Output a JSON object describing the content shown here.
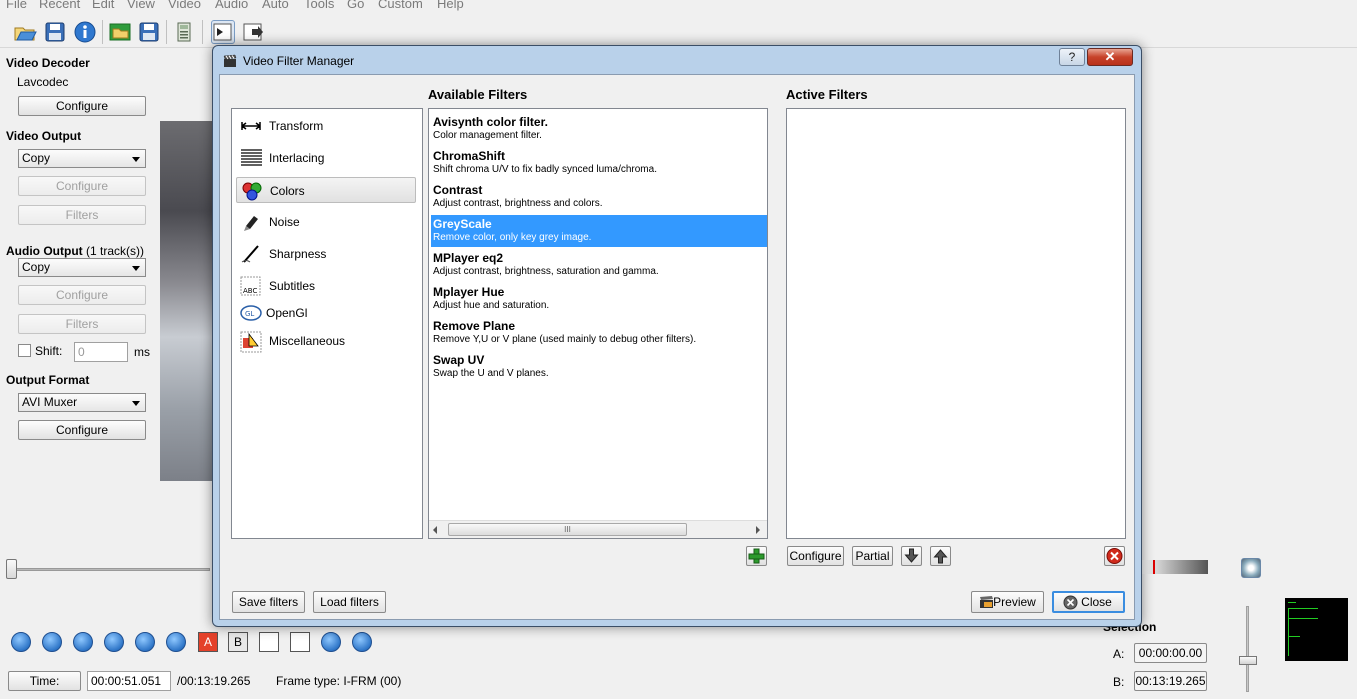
{
  "menu": [
    "File",
    "Recent",
    "Edit",
    "View",
    "Video",
    "Audio",
    "Auto",
    "Tools",
    "Go",
    "Custom",
    "Help"
  ],
  "left_panel": {
    "video_decoder": {
      "title": "Video Decoder",
      "codec": "Lavcodec",
      "configure": "Configure"
    },
    "video_output": {
      "title": "Video Output",
      "selected": "Copy",
      "configure": "Configure",
      "filters": "Filters"
    },
    "audio_output": {
      "title": "Audio Output",
      "tracks": "(1 track(s))",
      "selected": "Copy",
      "configure": "Configure",
      "filters": "Filters",
      "shift_label": "Shift:",
      "shift_value": "0",
      "shift_unit": "ms"
    },
    "output_format": {
      "title": "Output Format",
      "selected": "AVI Muxer",
      "configure": "Configure"
    }
  },
  "bottom": {
    "time_button": "Time:",
    "current_time": "00:00:51.051",
    "total_time": "/00:13:19.265",
    "frame_type": "Frame type:  I-FRM (00)",
    "selection_title": "Selection",
    "a_label": "A:",
    "a_value": "00:00:00.00",
    "b_label": "B:",
    "b_value": "00:13:19.265",
    "marker_a": "A",
    "marker_b": "B"
  },
  "dialog": {
    "title": "Video Filter Manager",
    "help": "?",
    "close_x": "✕",
    "categories": [
      {
        "label": "Transform",
        "icon": "transform-icon"
      },
      {
        "label": "Interlacing",
        "icon": "interlacing-icon"
      },
      {
        "label": "Colors",
        "icon": "colors-icon"
      },
      {
        "label": "Noise",
        "icon": "noise-icon"
      },
      {
        "label": "Sharpness",
        "icon": "sharpness-icon"
      },
      {
        "label": "Subtitles",
        "icon": "subtitles-icon"
      },
      {
        "label": "OpenGl",
        "icon": "opengl-icon"
      },
      {
        "label": "Miscellaneous",
        "icon": "miscellaneous-icon"
      }
    ],
    "selected_category": "Colors",
    "available_header": "Available Filters",
    "active_header": "Active Filters",
    "filters": [
      {
        "name": "Avisynth color filter.",
        "desc": "Color management filter."
      },
      {
        "name": "ChromaShift",
        "desc": "Shift chroma U/V to fix badly synced luma/chroma."
      },
      {
        "name": "Contrast",
        "desc": "Adjust contrast, brightness and colors."
      },
      {
        "name": "GreyScale",
        "desc": "Remove color, only key grey image."
      },
      {
        "name": "MPlayer eq2",
        "desc": "Adjust contrast, brightness, saturation and gamma."
      },
      {
        "name": "Mplayer Hue",
        "desc": "Adjust hue and saturation."
      },
      {
        "name": "Remove Plane",
        "desc": "Remove Y,U or V plane (used mainly to debug other filters)."
      },
      {
        "name": "Swap UV",
        "desc": "Swap the U and V planes."
      }
    ],
    "selected_filter": "GreyScale",
    "configure": "Configure",
    "partial": "Partial",
    "save_filters": "Save filters",
    "load_filters": "Load filters",
    "preview": "Preview",
    "close": "Close",
    "scroll_grip": "III"
  },
  "colors": {
    "selection": "#3399ff",
    "title_bar": "#b9d1ea",
    "close_red": "#c7422a"
  }
}
